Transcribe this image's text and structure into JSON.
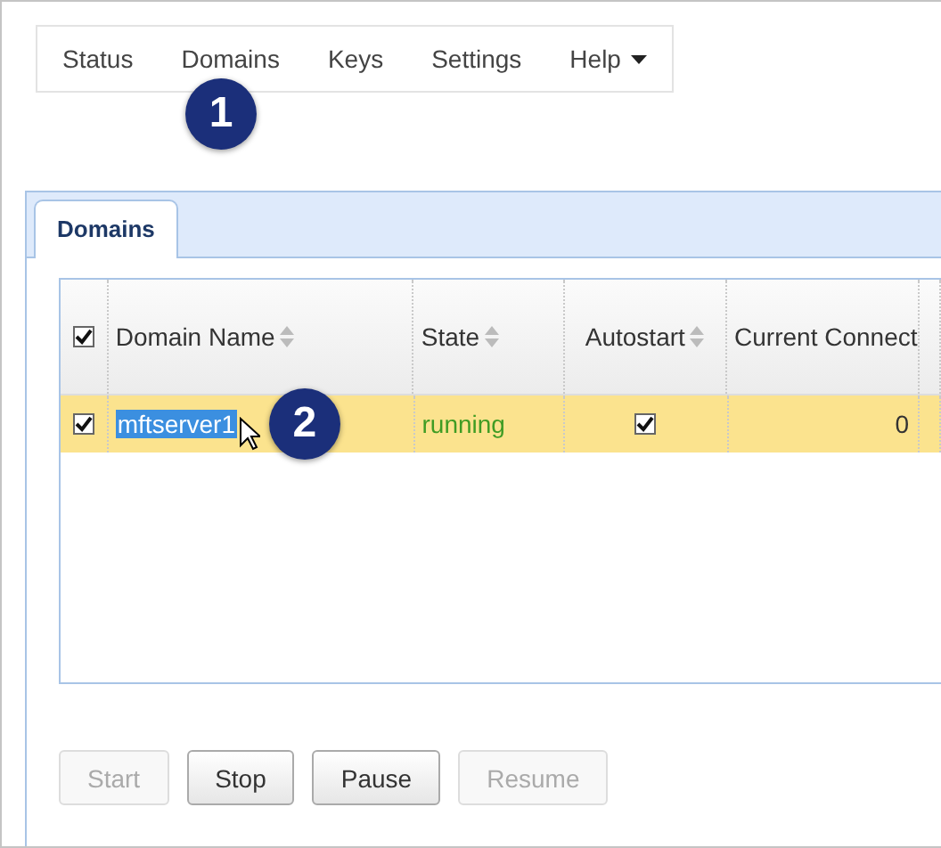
{
  "nav": {
    "items": [
      {
        "label": "Status",
        "kind": "link"
      },
      {
        "label": "Domains",
        "kind": "link"
      },
      {
        "label": "Keys",
        "kind": "link"
      },
      {
        "label": "Settings",
        "kind": "link"
      },
      {
        "label": "Help",
        "kind": "dropdown"
      }
    ]
  },
  "callouts": [
    "1",
    "2"
  ],
  "tabs": [
    {
      "label": "Domains",
      "selected": true
    }
  ],
  "table": {
    "select_all": {
      "checked": true
    },
    "columns": [
      {
        "label": "Domain Name",
        "sortable": true
      },
      {
        "label": "State",
        "sortable": true
      },
      {
        "label": "Autostart",
        "sortable": true
      },
      {
        "label": "Current Connect",
        "sortable": false
      }
    ],
    "rows": [
      {
        "checked": true,
        "selected": true,
        "domain_name": "mftserver1",
        "name_highlighted": true,
        "state": "running",
        "autostart": true,
        "current_connections": "0"
      }
    ]
  },
  "buttons": [
    {
      "label": "Start",
      "disabled": true
    },
    {
      "label": "Stop",
      "disabled": false
    },
    {
      "label": "Pause",
      "disabled": false
    },
    {
      "label": "Resume",
      "disabled": true
    }
  ]
}
